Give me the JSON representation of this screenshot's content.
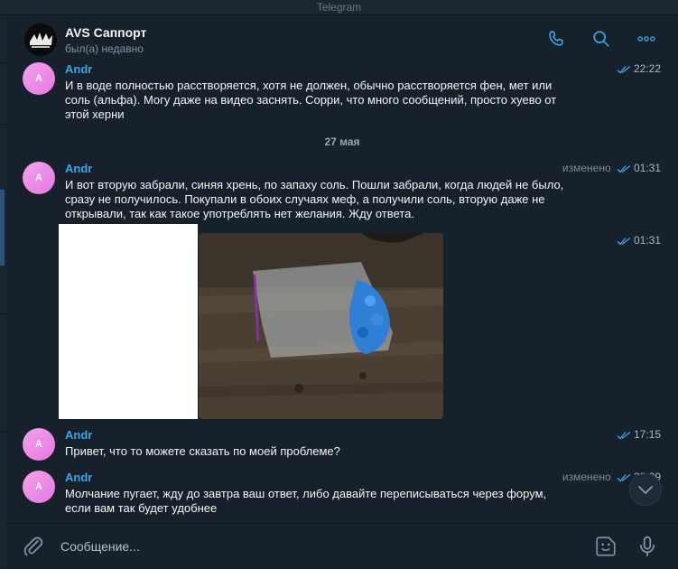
{
  "window": {
    "title": "Telegram"
  },
  "header": {
    "title": "AVS Саппорт",
    "status": "был(а) недавно",
    "icons": [
      "phone-icon",
      "search-icon",
      "more-icon"
    ]
  },
  "date_separator": "27 мая",
  "messages": [
    {
      "author": "Andr",
      "avatar_letter": "A",
      "text": "И в воде полностью расстворяется, хотя не должен, обычно расстворяется фен, мет или соль (альфа). Могу даже на видео заснять. Сорри, что много сообщений, просто хуево от этой херни",
      "edited": "",
      "time": "22:22"
    },
    {
      "author": "Andr",
      "avatar_letter": "A",
      "text": "И вот вторую забрали, синяя хрень, по запаху соль. Пошли забрали, когда людей не было, сразу не получилось. Покупали в обоих случаях меф, а получили соль, вторую даже не открывали, так как такое употреблять нет желания. Жду ответа.",
      "edited": "изменено",
      "time": "01:31"
    },
    {
      "type": "photo",
      "time": "01:31"
    },
    {
      "author": "Andr",
      "avatar_letter": "A",
      "text": "Привет, что то можете сказать по моей проблеме?",
      "edited": "",
      "time": "17:15"
    },
    {
      "author": "Andr",
      "avatar_letter": "A",
      "text": "Молчание пугает, жду до завтра ваш ответ, либо давайте переписываться через форум, если вам так будет удобнее",
      "edited": "изменено",
      "time": "23:29"
    }
  ],
  "composer": {
    "placeholder": "Сообщение...",
    "icons": [
      "attach-icon",
      "sticker-icon",
      "microphone-icon"
    ]
  },
  "colors": {
    "background": "#17212b",
    "accent": "#3fa4e6",
    "text": "#f5f5f5",
    "secondary": "#7f91a4"
  }
}
